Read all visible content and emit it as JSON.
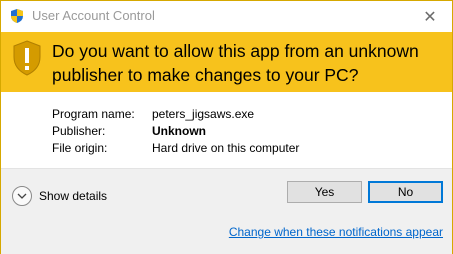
{
  "window": {
    "title": "User Account Control",
    "close_glyph": "✕"
  },
  "banner": {
    "question": "Do you want to allow this app from an unknown publisher to make changes to your PC?",
    "color": "#f7c21c"
  },
  "details": {
    "program_name_label": "Program name:",
    "program_name_value": "peters_jigsaws.exe",
    "publisher_label": "Publisher:",
    "publisher_value": "Unknown",
    "file_origin_label": "File origin:",
    "file_origin_value": "Hard drive on this computer"
  },
  "footer": {
    "show_details_label": "Show details",
    "yes_label": "Yes",
    "no_label": "No",
    "notifications_link": "Change when these notifications appear"
  },
  "icons": {
    "title": "uac-shield-icon",
    "banner": "warning-shield-icon",
    "show_details": "chevron-down-icon"
  }
}
